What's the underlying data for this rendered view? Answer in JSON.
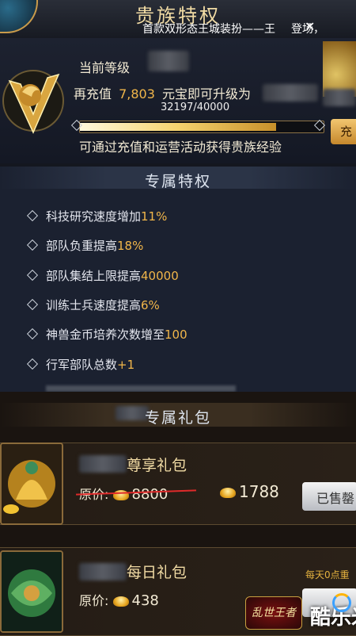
{
  "header": {
    "title": "贵族特权",
    "ticker": "首款双形态王城装扮——王",
    "ticker_tail": "登场，",
    "close_icon": "close-icon",
    "back_icon": "back-swirl-icon"
  },
  "level": {
    "current_label": "当前等级",
    "recharge_prefix": "再充值",
    "recharge_amount": "7,803",
    "recharge_suffix": "元宝即可升级为",
    "exp_text": "32197/40000",
    "exp_fraction": 0.805,
    "hint": "可通过充值和运营活动获得贵族经验",
    "recharge_button": "充"
  },
  "perks": {
    "title": "专属特权",
    "items": [
      {
        "text": "科技研究速度增加",
        "value": "11%"
      },
      {
        "text": "部队负重提高",
        "value": "18%"
      },
      {
        "text": "部队集结上限提高",
        "value": "40000"
      },
      {
        "text": "训练士兵速度提高",
        "value": "6%"
      },
      {
        "text": "神兽金币培养次数增至",
        "value": "100"
      },
      {
        "text": "行军部队总数",
        "value": "+1"
      }
    ]
  },
  "gifts": {
    "title": "专属礼包",
    "items": [
      {
        "name": "尊享礼包",
        "orig_label": "原价:",
        "orig_price": "8800",
        "price": "1788",
        "button": "已售罄"
      },
      {
        "name": "每日礼包",
        "orig_label": "原价:",
        "orig_price": "438",
        "note": "每天0点重"
      }
    ]
  },
  "watermark": {
    "logo_text": "乱世王者",
    "site_text": "酷乐米"
  },
  "colors": {
    "accent_gold": "#f1b64a",
    "panel": "#1b2130"
  }
}
